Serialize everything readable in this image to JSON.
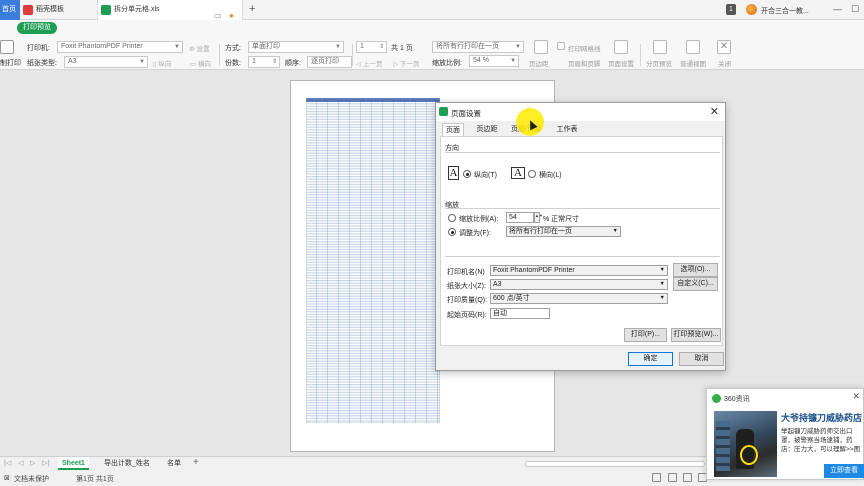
{
  "tabs": {
    "home": "首页",
    "doc1": "稻壳模板",
    "doc2": "拆分单元格.xls",
    "new_tab": "+",
    "badge": "1",
    "user": "开合三合一教..."
  },
  "ribbon": {
    "mode_label": "打印预览",
    "printer_label": "打印机:",
    "printer_value": "Foxit PhantomPDF Printer",
    "settings_btn": "设置",
    "paper_label": "纸张类型:",
    "paper_value": "A3",
    "portrait_btn": "纵向",
    "landscape_btn": "横向",
    "method_label": "方式:",
    "method_value": "单面打印",
    "copies_label": "份数:",
    "copies_value": "1",
    "order_label": "顺序:",
    "order_value": "逐页打印",
    "page_from": "1",
    "page_total": "共 1 页",
    "prev_btn": "上一页",
    "next_btn": "下一页",
    "fit_value": "将所有行打印在一页",
    "zoom_label": "缩放比例:",
    "zoom_value": "54 %",
    "margins_btn": "页边距",
    "gridlines_btn": "打印网格线",
    "header_btn": "页眉和页脚",
    "page_setup_btn": "页面设置",
    "pagebreak_btn": "分页预览",
    "normal_btn": "普通视图",
    "close_btn": "关闭",
    "left_label": "制打印"
  },
  "dialog": {
    "title": "页面设置",
    "tabs": [
      "页面",
      "页边距",
      "页眉/页脚",
      "工作表"
    ],
    "orientation_header": "方向",
    "portrait": "纵向(T)",
    "landscape": "横向(L)",
    "scaling_header": "缩放",
    "scale_option": "缩放比例(A):",
    "scale_value": "54",
    "scale_suffix": "% 正常尺寸",
    "fit_option": "调整为(F):",
    "fit_value": "将所有行打印在一页",
    "printer_label": "打印机名(N)",
    "printer_value": "Foxit PhantomPDF Printer",
    "options_btn": "选项(O)...",
    "paper_label": "纸张大小(Z):",
    "paper_value": "A3",
    "custom_btn": "自定义(C)...",
    "quality_label": "打印质量(Q):",
    "quality_value": "600 点/英寸",
    "first_page_label": "起始页码(R):",
    "first_page_value": "自动",
    "print_btn": "打印(P)...",
    "preview_btn": "打印预览(W)...",
    "ok_btn": "确定",
    "cancel_btn": "取消"
  },
  "sheets": {
    "tabs": [
      "Sheet1",
      "导出计数_姓名",
      "名单"
    ],
    "add": "+"
  },
  "status": {
    "protect": "文档未保护",
    "pages": "第1页 共1页"
  },
  "notification": {
    "source": "360资讯",
    "headline": "大爷持镰刀威胁药店",
    "body": "举起镰刀威胁药师交出口罩，被警察当场逮捕，药店：压力大，可以理解>>图",
    "cta": "立即查看"
  },
  "colors": {
    "accent_green": "#1e9e54",
    "home_blue": "#3b7ddd",
    "dialog_default_border": "#0078d7",
    "notif_headline": "#1a4f8a",
    "cursor_highlight": "#ffeb00"
  }
}
